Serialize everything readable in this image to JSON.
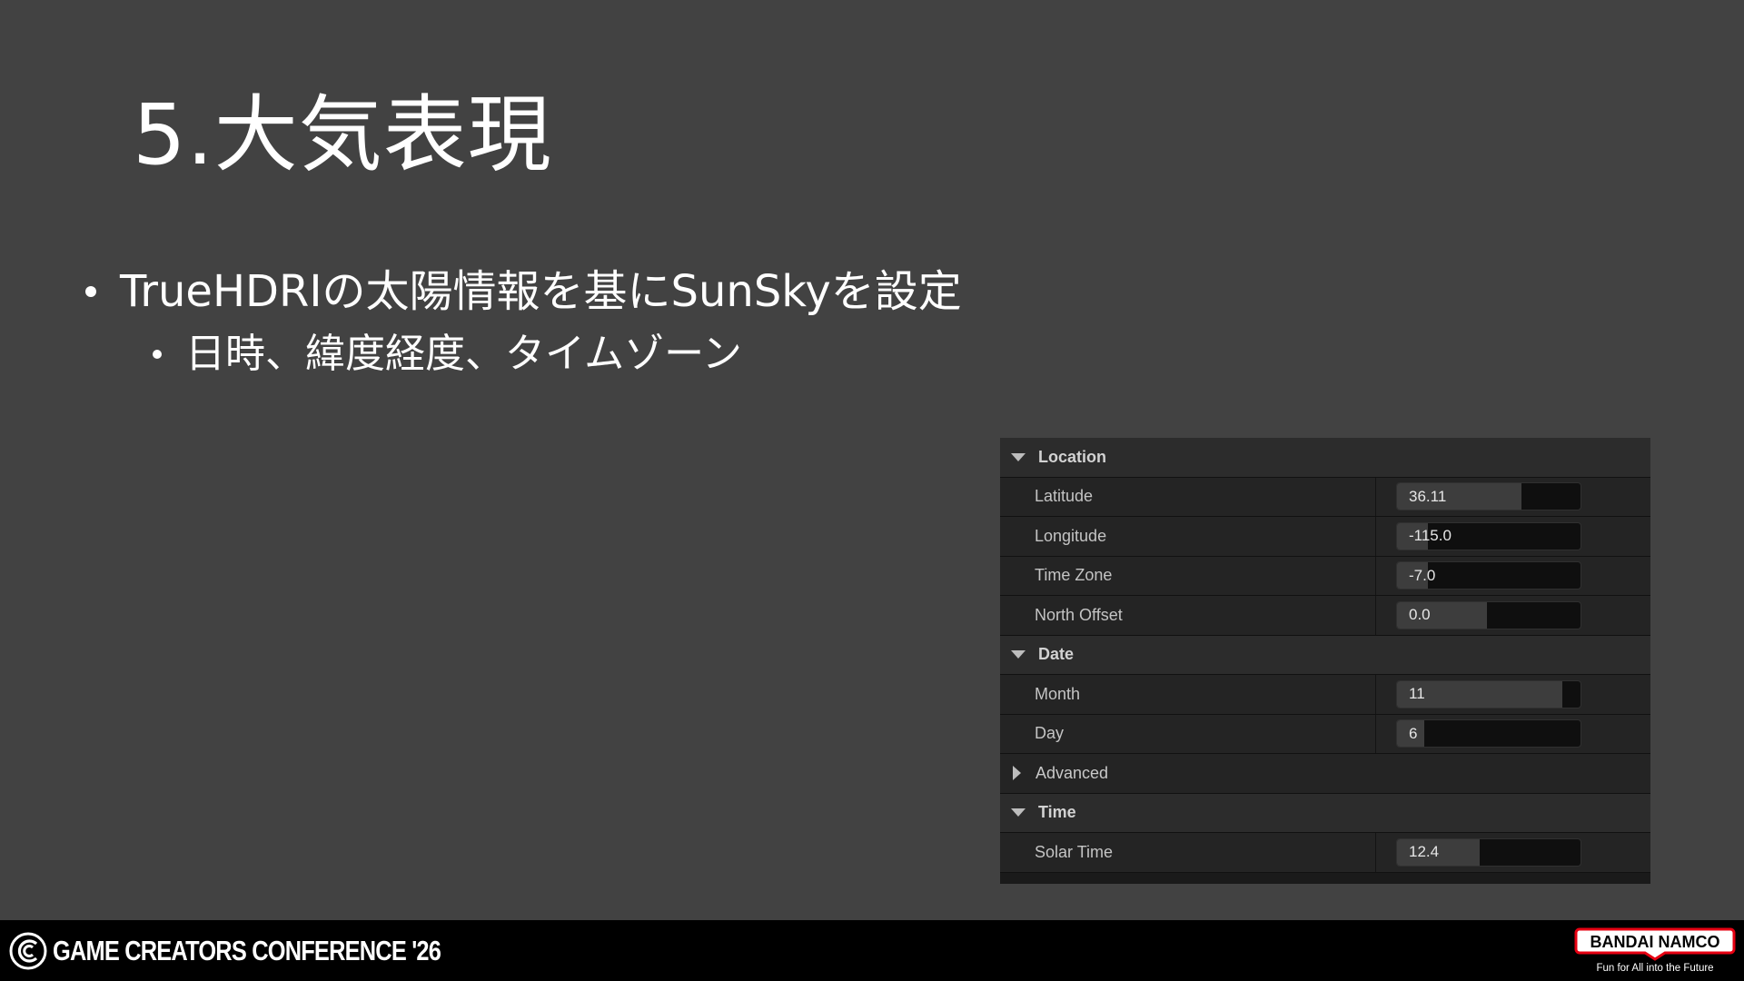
{
  "slide": {
    "title": "5.大気表現",
    "bullet_1": "TrueHDRIの太陽情報を基にSunSkyを設定",
    "bullet_2": "日時、緯度経度、タイムゾーン"
  },
  "panel": {
    "location": {
      "label": "Location",
      "latitude": {
        "name": "Latitude",
        "value": "36.11",
        "fill": 0.68
      },
      "longitude": {
        "name": "Longitude",
        "value": "-115.0",
        "fill": 0.17
      },
      "time_zone": {
        "name": "Time Zone",
        "value": "-7.0",
        "fill": 0.17
      },
      "north_offset": {
        "name": "North Offset",
        "value": "0.0",
        "fill": 0.49
      }
    },
    "date": {
      "label": "Date",
      "month": {
        "name": "Month",
        "value": "11",
        "fill": 0.9
      },
      "day": {
        "name": "Day",
        "value": "6",
        "fill": 0.15
      },
      "advanced": "Advanced"
    },
    "time": {
      "label": "Time",
      "solar_time": {
        "name": "Solar Time",
        "value": "12.4",
        "fill": 0.45
      }
    }
  },
  "footer": {
    "conference": "GAME CREATORS CONFERENCE '26",
    "brand": "BANDAI NAMCO",
    "tagline": "Fun for All into the Future"
  },
  "colors": {
    "background": "#424242",
    "footer": "#000000",
    "brand_red": "#e60012"
  }
}
